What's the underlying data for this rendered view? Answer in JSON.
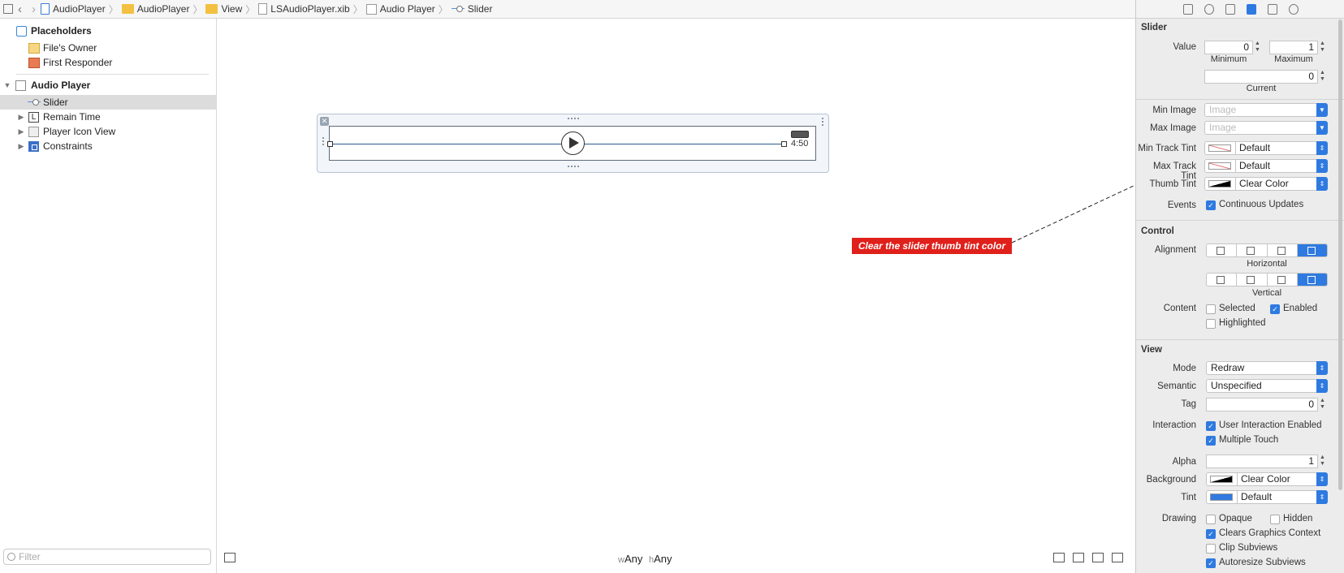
{
  "breadcrumb": {
    "items": [
      "AudioPlayer",
      "AudioPlayer",
      "View",
      "LSAudioPlayer.xib",
      "Audio Player",
      "Slider"
    ]
  },
  "outline": {
    "placeholders_title": "Placeholders",
    "files_owner": "File's Owner",
    "first_responder": "First Responder",
    "root": "Audio Player",
    "children": [
      "Slider",
      "Remain Time",
      "Player Icon View",
      "Constraints"
    ],
    "filter_placeholder": "Filter"
  },
  "canvas": {
    "time_label": "4:50",
    "size_class_w_prefix": "w",
    "size_class_w": "Any",
    "size_class_h_prefix": "h",
    "size_class_h": "Any"
  },
  "callout": {
    "text": "Clear the slider thumb tint color",
    "color": "#e0201b"
  },
  "inspector": {
    "slider": {
      "title": "Slider",
      "value_label": "Value",
      "minimum": "0",
      "maximum": "1",
      "minimum_label": "Minimum",
      "maximum_label": "Maximum",
      "current": "0",
      "current_label": "Current",
      "min_image_label": "Min Image",
      "min_image_placeholder": "Image",
      "max_image_label": "Max Image",
      "max_image_placeholder": "Image",
      "min_track_tint_label": "Min Track Tint",
      "min_track_tint": "Default",
      "max_track_tint_label": "Max Track Tint",
      "max_track_tint": "Default",
      "thumb_tint_label": "Thumb Tint",
      "thumb_tint": "Clear Color",
      "events_label": "Events",
      "continuous_updates": "Continuous Updates"
    },
    "control": {
      "title": "Control",
      "alignment_label": "Alignment",
      "horizontal_label": "Horizontal",
      "vertical_label": "Vertical",
      "content_label": "Content",
      "selected": "Selected",
      "enabled": "Enabled",
      "highlighted": "Highlighted"
    },
    "view": {
      "title": "View",
      "mode_label": "Mode",
      "mode": "Redraw",
      "semantic_label": "Semantic",
      "semantic": "Unspecified",
      "tag_label": "Tag",
      "tag": "0",
      "interaction_label": "Interaction",
      "user_interaction": "User Interaction Enabled",
      "multiple_touch": "Multiple Touch",
      "alpha_label": "Alpha",
      "alpha": "1",
      "background_label": "Background",
      "background": "Clear Color",
      "tint_label": "Tint",
      "tint": "Default",
      "drawing_label": "Drawing",
      "opaque": "Opaque",
      "hidden": "Hidden",
      "clears_graphics": "Clears Graphics Context",
      "clip_subviews": "Clip Subviews",
      "autoresize_subviews": "Autoresize Subviews"
    }
  }
}
